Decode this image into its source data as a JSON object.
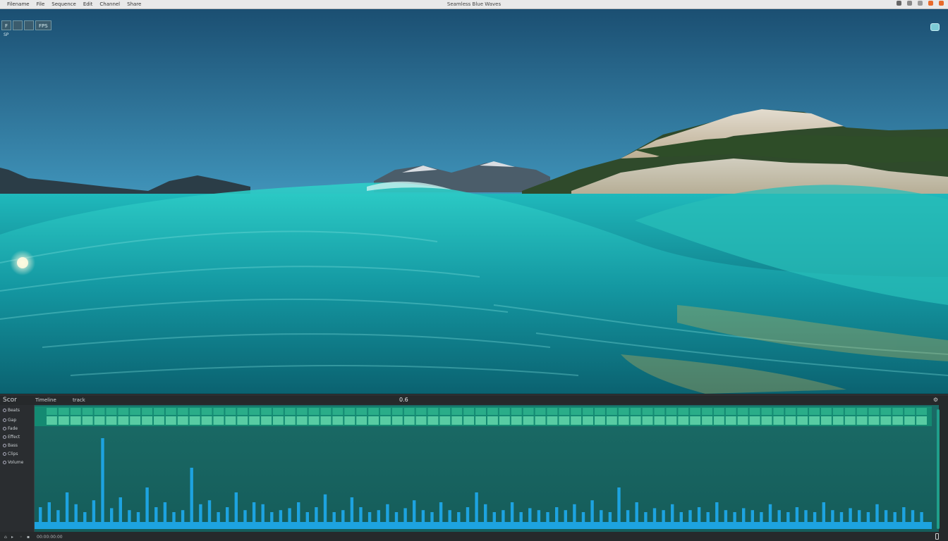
{
  "app": {
    "window_title": "Seamless Blue Waves"
  },
  "menubar": {
    "items": [
      "Filename",
      "File",
      "Sequence",
      "Edit",
      "Channel",
      "Share"
    ],
    "right_icons": [
      "sync-icon",
      "bell-icon",
      "window-icon",
      "record-icon",
      "close-icon"
    ],
    "accent_color": "#e86a2b"
  },
  "viewport": {
    "toolbar": [
      "F",
      "",
      "",
      "FPS"
    ],
    "sub_label": "SP"
  },
  "panel": {
    "title": "Scor",
    "label_a": "Timeline",
    "label_b": "track",
    "center_label": "0.6",
    "side_items": [
      "Beats",
      "Gap",
      "Fade",
      "Effect",
      "Bass",
      "Clips",
      "Volume"
    ],
    "status_left": "00:00:00:00"
  },
  "colors": {
    "timeline_bg": "#155c5a",
    "track_cell": "#5fd3a8",
    "waveform": "#1da3e0",
    "accent_teal": "#1f9e8a"
  },
  "timeline": {
    "cells_per_row": 74,
    "waveform_levels": [
      0.15,
      0.2,
      0.12,
      0.3,
      0.18,
      0.1,
      0.22,
      0.85,
      0.14,
      0.25,
      0.12,
      0.1,
      0.35,
      0.15,
      0.2,
      0.1,
      0.12,
      0.55,
      0.18,
      0.22,
      0.1,
      0.15,
      0.3,
      0.12,
      0.2,
      0.18,
      0.1,
      0.12,
      0.14,
      0.2,
      0.1,
      0.15,
      0.28,
      0.1,
      0.12,
      0.25,
      0.15,
      0.1,
      0.12,
      0.18,
      0.1,
      0.14,
      0.22,
      0.12,
      0.1,
      0.2,
      0.12,
      0.1,
      0.15,
      0.3,
      0.18,
      0.1,
      0.12,
      0.2,
      0.1,
      0.14,
      0.12,
      0.1,
      0.15,
      0.12,
      0.18,
      0.1,
      0.22,
      0.12,
      0.1,
      0.35,
      0.12,
      0.2,
      0.1,
      0.14,
      0.12,
      0.18,
      0.1,
      0.12,
      0.15,
      0.1,
      0.2,
      0.12,
      0.1,
      0.14,
      0.12,
      0.1,
      0.18,
      0.12,
      0.1,
      0.15,
      0.12,
      0.1,
      0.2,
      0.12,
      0.1,
      0.14,
      0.12,
      0.1,
      0.18,
      0.12,
      0.1,
      0.15,
      0.12,
      0.1
    ]
  }
}
